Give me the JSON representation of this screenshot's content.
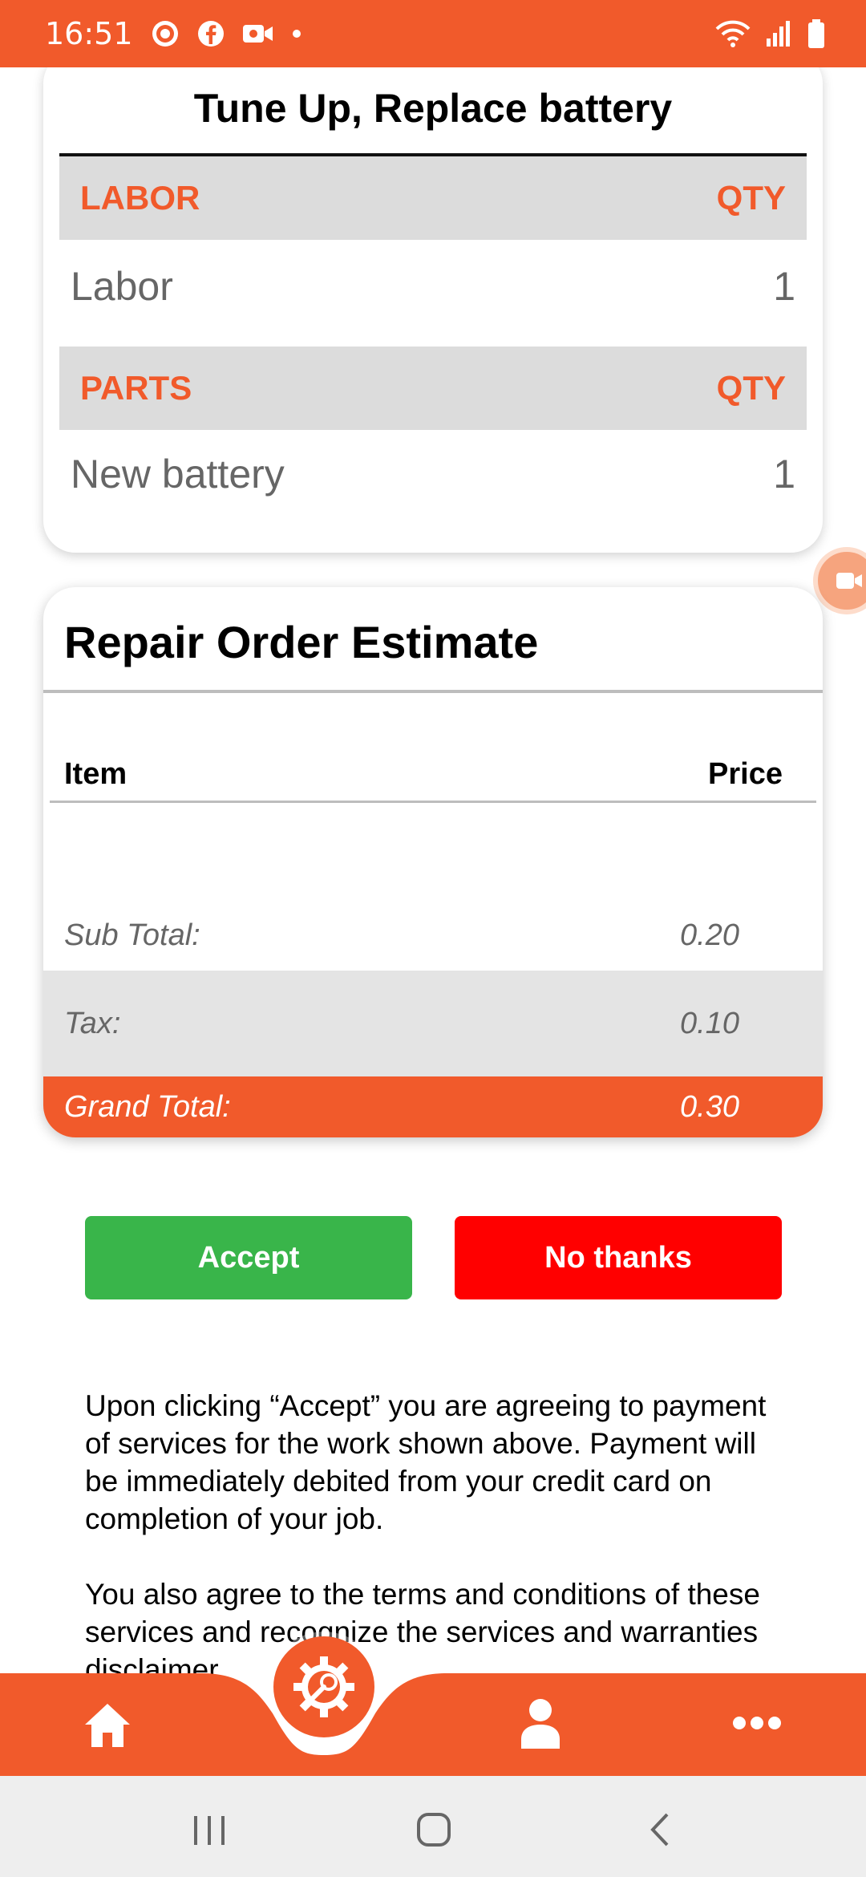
{
  "status_bar": {
    "time": "16:51",
    "left_icons": [
      "app-badge-icon",
      "facebook-icon",
      "video-icon",
      "dot-icon"
    ],
    "right_icons": [
      "wifi-icon",
      "signal-icon",
      "battery-icon"
    ]
  },
  "job_card": {
    "title": "Tune Up, Replace battery",
    "labor": {
      "header": "LABOR",
      "qty_header": "QTY",
      "items": [
        {
          "name": "Labor",
          "qty": "1"
        }
      ]
    },
    "parts": {
      "header": "PARTS",
      "qty_header": "QTY",
      "items": [
        {
          "name": "New battery",
          "qty": "1"
        }
      ]
    }
  },
  "estimate": {
    "title": "Repair Order Estimate",
    "col_item": "Item",
    "col_price": "Price",
    "subtotal_label": "Sub Total:",
    "subtotal_value": "0.20",
    "tax_label": "Tax:",
    "tax_value": "0.10",
    "grand_label": "Grand Total:",
    "grand_value": "0.30"
  },
  "actions": {
    "accept_label": "Accept",
    "decline_label": "No thanks"
  },
  "legal": {
    "p1": "Upon clicking “Accept” you are agreeing to payment of services for the work shown above. Payment will be immediately debited from your credit card on completion of your job.",
    "p2": "You also agree to the terms and conditions of these services and recognize the services and warranties disclaimer."
  },
  "bottom_nav": {
    "items": [
      "home-icon",
      "service-icon",
      "profile-icon",
      "more-icon"
    ]
  },
  "colors": {
    "brand": "#F15A2B",
    "accept": "#39B54A",
    "decline": "#FF0000",
    "section_header_bg": "#DCDCDC"
  }
}
